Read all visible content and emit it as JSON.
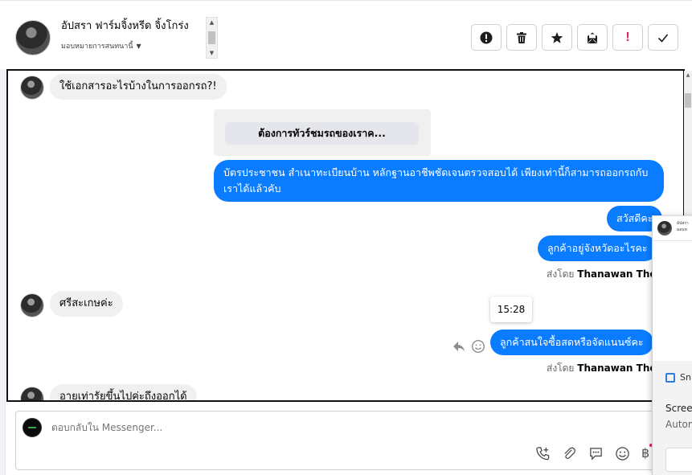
{
  "header": {
    "contact_name": "อัปสรา ฟาร์มจิ้งหรีด จิ้งโกร่ง",
    "assign_label": "มอบหมายการสนทนานี้",
    "toolbar": [
      {
        "name": "spam-button",
        "icon": "alert-icon"
      },
      {
        "name": "delete-button",
        "icon": "trash-icon"
      },
      {
        "name": "star-button",
        "icon": "star-icon"
      },
      {
        "name": "mark-unread-button",
        "icon": "envelope-icon"
      },
      {
        "name": "important-button",
        "icon": "exclamation-icon",
        "label": "!"
      },
      {
        "name": "done-button",
        "icon": "check-icon"
      }
    ]
  },
  "messages": {
    "m1": "ใช้เอกสารอะไรบ้างในการออกรถ?!",
    "card_button": "ต้องการทัวร์ชมรถของเราค...",
    "m2": "บัตรประชาชน สำเนาทะเบียนบ้าน หลักฐานอาชีพชัดเจนตรวจสอบได้ เพียงเท่านี้ก็สามารถออกรถกับเราได้แล้วคับ",
    "m3": "สวัสดีคะ",
    "m4": "ลูกค้าอยู่จังหวัดอะไรคะ",
    "sent_by_1_prefix": "ส่งโดย",
    "sent_by_1_name": "Thanawan Thon",
    "m5": "ศรีสะเกษค่ะ",
    "time": "15:28",
    "m6": "ลูกค้าสนใจซื้อสดหรือจัดแนนซ์คะ",
    "sent_by_2_prefix": "ส่งโดย",
    "sent_by_2_name": "Thanawan Thon",
    "m7": "อายเท่ารัยขึ้นไปค่ะถึงออกได้"
  },
  "composer": {
    "placeholder": "ตอบกลับใน Messenger..."
  },
  "popup": {
    "mini_name_1": "อัปสรา",
    "mini_name_2": "มอบห",
    "snip_label": "Sn",
    "line1": "Scree",
    "line2": "Autom"
  },
  "colors": {
    "accent_blue": "#0a7cff",
    "incoming_bubble": "#f0f0f0",
    "important_red": "#e0245e"
  }
}
